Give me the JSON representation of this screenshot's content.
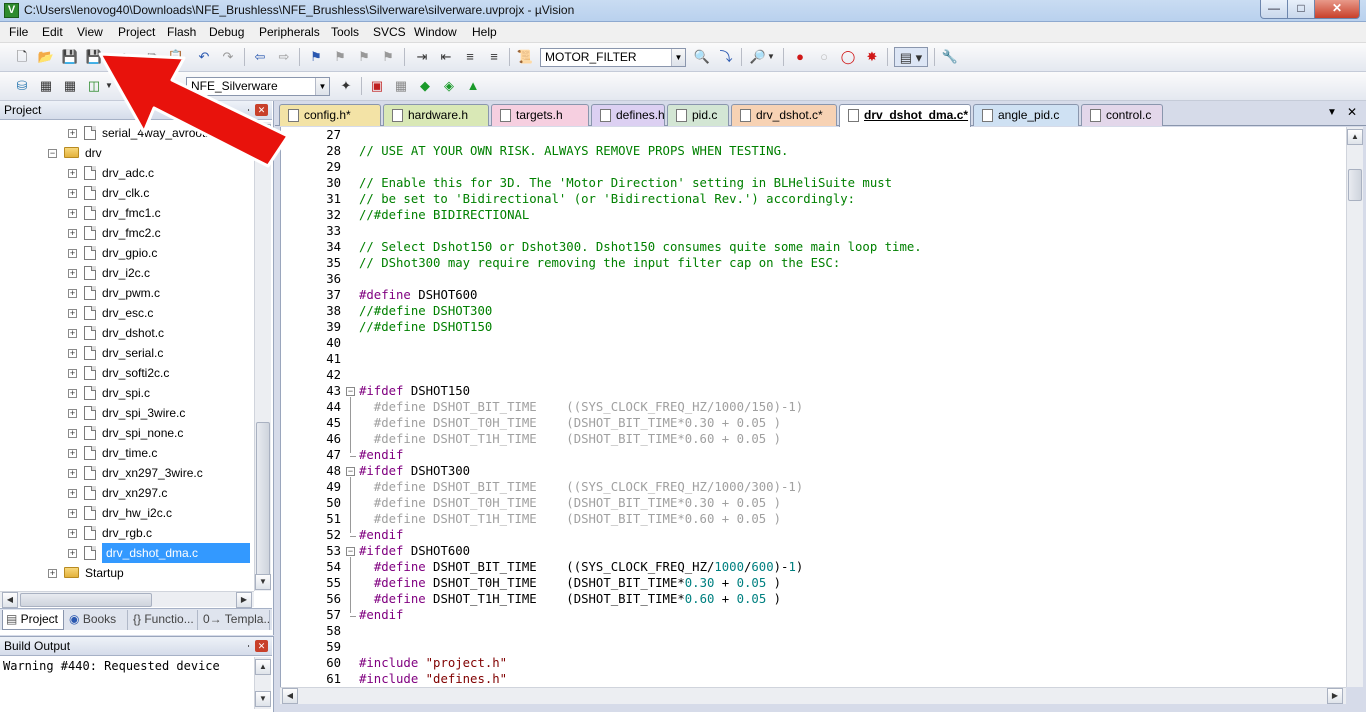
{
  "window": {
    "title": "C:\\Users\\lenovog40\\Downloads\\NFE_Brushless\\NFE_Brushless\\Silverware\\silverware.uvprojx - µVision",
    "app_icon": "V",
    "min_icon": "minimize-icon",
    "max_icon": "maximize-icon",
    "close_icon": "close-icon"
  },
  "menu": [
    "File",
    "Edit",
    "View",
    "Project",
    "Flash",
    "Debug",
    "Peripherals",
    "Tools",
    "SVCS",
    "Window",
    "Help"
  ],
  "toolbar": {
    "find_combo": "MOTOR_FILTER",
    "target_combo": "NFE_Silverware"
  },
  "project_panel": {
    "title": "Project",
    "tree": [
      {
        "label": "serial_4way_avrootloader.c",
        "type": "file",
        "level": 2
      },
      {
        "label": "drv",
        "type": "folder",
        "level": 1,
        "expanded": true
      },
      {
        "label": "drv_adc.c",
        "type": "file",
        "level": 2
      },
      {
        "label": "drv_clk.c",
        "type": "file",
        "level": 2
      },
      {
        "label": "drv_fmc1.c",
        "type": "file",
        "level": 2
      },
      {
        "label": "drv_fmc2.c",
        "type": "file",
        "level": 2
      },
      {
        "label": "drv_gpio.c",
        "type": "file",
        "level": 2
      },
      {
        "label": "drv_i2c.c",
        "type": "file",
        "level": 2
      },
      {
        "label": "drv_pwm.c",
        "type": "file",
        "level": 2
      },
      {
        "label": "drv_esc.c",
        "type": "file",
        "level": 2
      },
      {
        "label": "drv_dshot.c",
        "type": "file",
        "level": 2
      },
      {
        "label": "drv_serial.c",
        "type": "file",
        "level": 2
      },
      {
        "label": "drv_softi2c.c",
        "type": "file",
        "level": 2
      },
      {
        "label": "drv_spi.c",
        "type": "file",
        "level": 2
      },
      {
        "label": "drv_spi_3wire.c",
        "type": "file",
        "level": 2
      },
      {
        "label": "drv_spi_none.c",
        "type": "file",
        "level": 2
      },
      {
        "label": "drv_time.c",
        "type": "file",
        "level": 2
      },
      {
        "label": "drv_xn297_3wire.c",
        "type": "file",
        "level": 2
      },
      {
        "label": "drv_xn297.c",
        "type": "file",
        "level": 2
      },
      {
        "label": "drv_hw_i2c.c",
        "type": "file",
        "level": 2
      },
      {
        "label": "drv_rgb.c",
        "type": "file",
        "level": 2
      },
      {
        "label": "drv_dshot_dma.c",
        "type": "file",
        "level": 2,
        "selected": true
      },
      {
        "label": "Startup",
        "type": "folder",
        "level": 1,
        "expanded": false
      }
    ],
    "tabs": [
      "Project",
      "Books",
      "{} Functio...",
      "0→ Templa..."
    ]
  },
  "build_output": {
    "title": "Build Output",
    "text": "Warning #440: Requested device"
  },
  "editor_tabs": [
    {
      "label": "config.h*",
      "color": "#f3e3a6"
    },
    {
      "label": "hardware.h",
      "color": "#d9e8b6"
    },
    {
      "label": "targets.h",
      "color": "#f6cfe0"
    },
    {
      "label": "defines.h",
      "color": "#dcd0f2"
    },
    {
      "label": "pid.c",
      "color": "#d3e6d4"
    },
    {
      "label": "drv_dshot.c*",
      "color": "#f7d2b4"
    },
    {
      "label": "drv_dshot_dma.c*",
      "color": "#ffffff",
      "active": true
    },
    {
      "label": "angle_pid.c",
      "color": "#cfe1f3"
    },
    {
      "label": "control.c",
      "color": "#e3d7ea"
    }
  ],
  "code_lines": [
    {
      "n": "27",
      "t": ""
    },
    {
      "n": "28",
      "t": "// USE AT YOUR OWN RISK. ALWAYS REMOVE PROPS WHEN TESTING."
    },
    {
      "n": "29",
      "t": ""
    },
    {
      "n": "30",
      "t": "// Enable this for 3D. The 'Motor Direction' setting in BLHeliSuite must"
    },
    {
      "n": "31",
      "t": "// be set to 'Bidirectional' (or 'Bidirectional Rev.') accordingly:"
    },
    {
      "n": "32",
      "t": "//#define BIDIRECTIONAL"
    },
    {
      "n": "33",
      "t": ""
    },
    {
      "n": "34",
      "t": "// Select Dshot150 or Dshot300. Dshot150 consumes quite some main loop time."
    },
    {
      "n": "35",
      "t": "// DShot300 may require removing the input filter cap on the ESC:"
    },
    {
      "n": "36",
      "t": ""
    },
    {
      "n": "37",
      "t": "#define DSHOT600"
    },
    {
      "n": "38",
      "t": "//#define DSHOT300"
    },
    {
      "n": "39",
      "t": "//#define DSHOT150"
    },
    {
      "n": "40",
      "t": ""
    },
    {
      "n": "41",
      "t": ""
    },
    {
      "n": "42",
      "t": ""
    },
    {
      "n": "43",
      "t": "#ifdef DSHOT150"
    },
    {
      "n": "44",
      "t": "  #define DSHOT_BIT_TIME    ((SYS_CLOCK_FREQ_HZ/1000/150)-1)"
    },
    {
      "n": "45",
      "t": "  #define DSHOT_T0H_TIME    (DSHOT_BIT_TIME*0.30 + 0.05 )"
    },
    {
      "n": "46",
      "t": "  #define DSHOT_T1H_TIME    (DSHOT_BIT_TIME*0.60 + 0.05 )"
    },
    {
      "n": "47",
      "t": "#endif"
    },
    {
      "n": "48",
      "t": "#ifdef DSHOT300"
    },
    {
      "n": "49",
      "t": "  #define DSHOT_BIT_TIME    ((SYS_CLOCK_FREQ_HZ/1000/300)-1)"
    },
    {
      "n": "50",
      "t": "  #define DSHOT_T0H_TIME    (DSHOT_BIT_TIME*0.30 + 0.05 )"
    },
    {
      "n": "51",
      "t": "  #define DSHOT_T1H_TIME    (DSHOT_BIT_TIME*0.60 + 0.05 )"
    },
    {
      "n": "52",
      "t": "#endif"
    },
    {
      "n": "53",
      "t": "#ifdef DSHOT600"
    },
    {
      "n": "54",
      "t": "  #define DSHOT_BIT_TIME    ((SYS_CLOCK_FREQ_HZ/1000/600)-1)"
    },
    {
      "n": "55",
      "t": "  #define DSHOT_T0H_TIME    (DSHOT_BIT_TIME*0.30 + 0.05 )"
    },
    {
      "n": "56",
      "t": "  #define DSHOT_T1H_TIME    (DSHOT_BIT_TIME*0.60 + 0.05 )"
    },
    {
      "n": "57",
      "t": "#endif"
    },
    {
      "n": "58",
      "t": ""
    },
    {
      "n": "59",
      "t": ""
    },
    {
      "n": "60",
      "t": "#include \"project.h\""
    },
    {
      "n": "61",
      "t": "#include \"defines.h\""
    }
  ],
  "colors": {
    "comment": "#008000",
    "keyword": "#800080",
    "inactive": "#a0a0a0",
    "number": "#008080",
    "string": "#800000",
    "selection": "#3399ff",
    "arrow": "#e8120c"
  }
}
